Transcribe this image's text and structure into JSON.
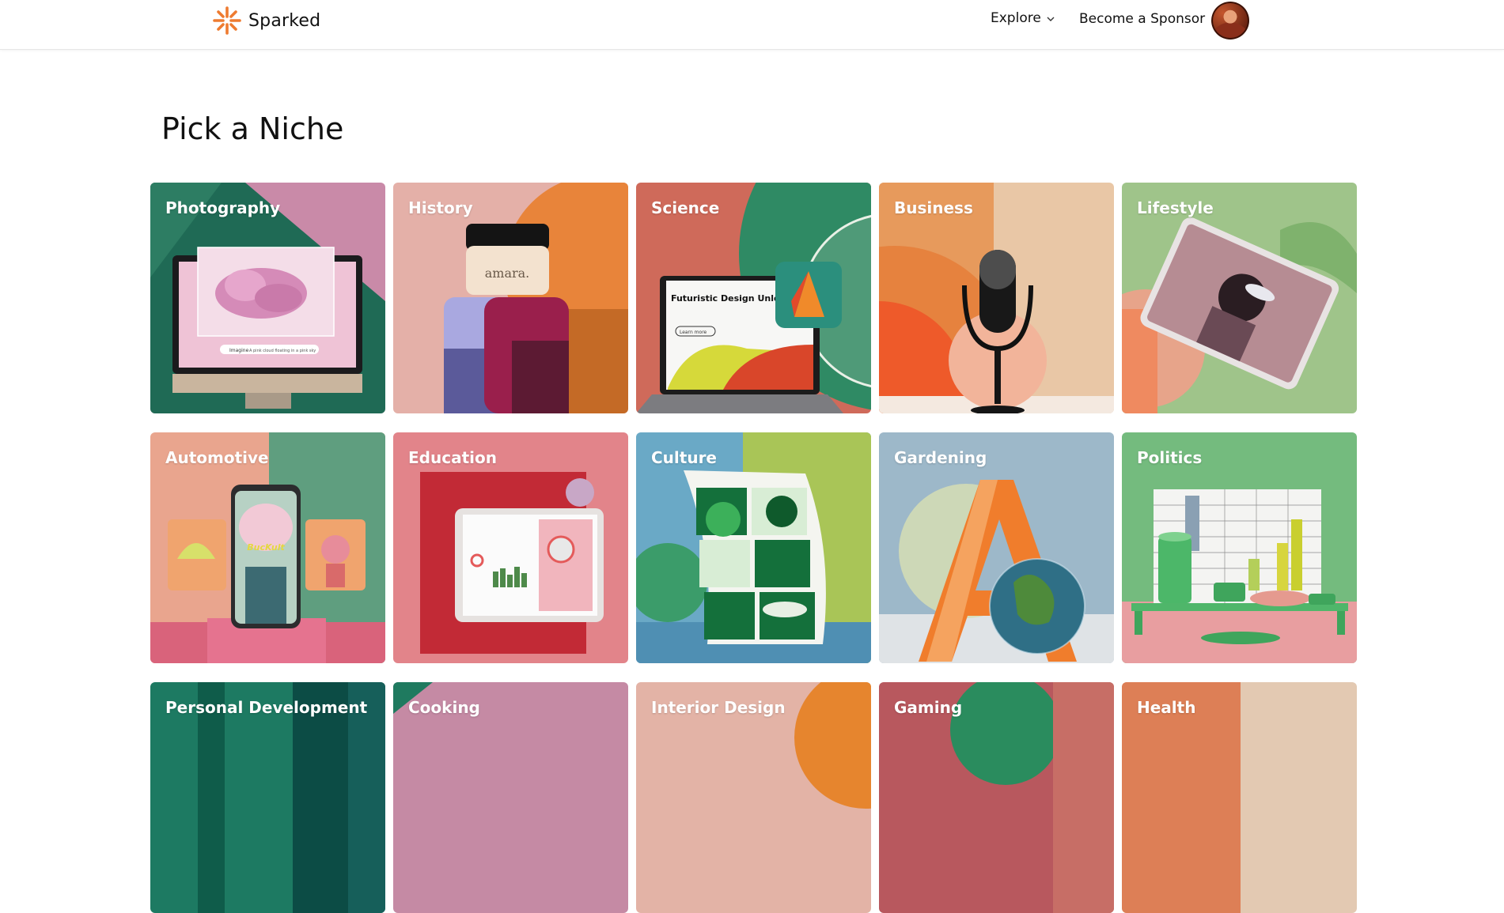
{
  "header": {
    "brand": "Sparked",
    "brand_icon": "sparkle-icon",
    "nav": {
      "explore": "Explore",
      "become_sponsor": "Become a Sponsor"
    },
    "accent_color": "#ee7b30"
  },
  "main": {
    "title": "Pick a Niche",
    "niches": [
      {
        "label": "Photography"
      },
      {
        "label": "History"
      },
      {
        "label": "Science"
      },
      {
        "label": "Business"
      },
      {
        "label": "Lifestyle"
      },
      {
        "label": "Automotive"
      },
      {
        "label": "Education"
      },
      {
        "label": "Culture"
      },
      {
        "label": "Gardening"
      },
      {
        "label": "Politics"
      },
      {
        "label": "Personal Development"
      },
      {
        "label": "Cooking"
      },
      {
        "label": "Interior Design"
      },
      {
        "label": "Gaming"
      },
      {
        "label": "Health"
      }
    ],
    "card_art": {
      "photography_caption_left": "Imagine",
      "photography_caption_right": "A pink cloud floating in a pink sky",
      "history_jar_label": "amara.",
      "science_heading": "Futuristic Design Unleashed",
      "science_button": "Learn more",
      "automotive_hat_text": "BucKult"
    }
  }
}
